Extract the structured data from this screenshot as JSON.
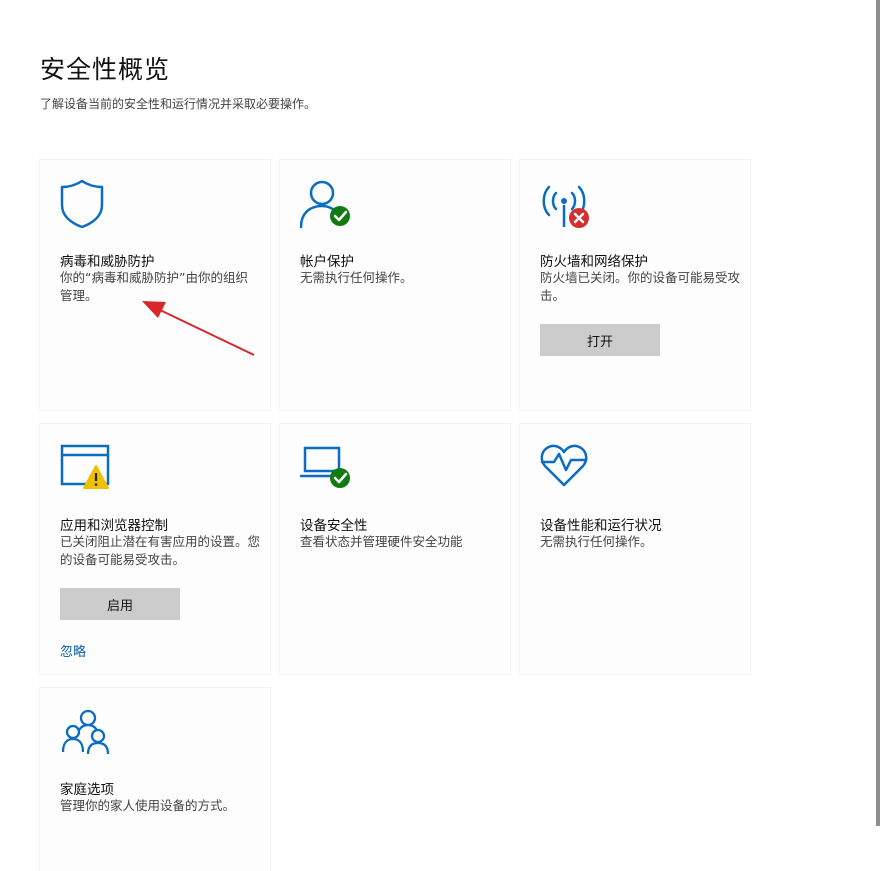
{
  "page": {
    "title": "安全性概览",
    "subtitle": "了解设备当前的安全性和运行情况并采取必要操作。"
  },
  "tiles": [
    {
      "icon": "shield-icon",
      "title": "病毒和威胁防护",
      "desc": "你的“病毒和威胁防护”由你的组织管理。"
    },
    {
      "icon": "account-protection-icon",
      "status_icon": "check-badge-icon",
      "title": "帐户保护",
      "desc": "无需执行任何操作。"
    },
    {
      "icon": "firewall-antenna-icon",
      "status_icon": "error-badge-icon",
      "title": "防火墙和网络保护",
      "desc": "防火墙已关闭。你的设备可能易受攻击。",
      "button": "打开"
    },
    {
      "icon": "app-browser-window-icon",
      "status_icon": "warning-badge-icon",
      "title": "应用和浏览器控制",
      "desc": "已关闭阻止潜在有害应用的设置。您的设备可能易受攻击。",
      "button": "启用",
      "link": "忽略"
    },
    {
      "icon": "laptop-icon",
      "status_icon": "check-badge-icon",
      "title": "设备安全性",
      "desc": "查看状态并管理硬件安全功能"
    },
    {
      "icon": "heart-pulse-icon",
      "title": "设备性能和运行状况",
      "desc": "无需执行任何操作。"
    },
    {
      "icon": "family-icon",
      "title": "家庭选项",
      "desc": "管理你的家人使用设备的方式。"
    }
  ],
  "colors": {
    "accent": "#0a6cc2",
    "ok": "#107c10",
    "error": "#d32f2f",
    "warning": "#f0c000",
    "annotation": "#d7262c"
  }
}
